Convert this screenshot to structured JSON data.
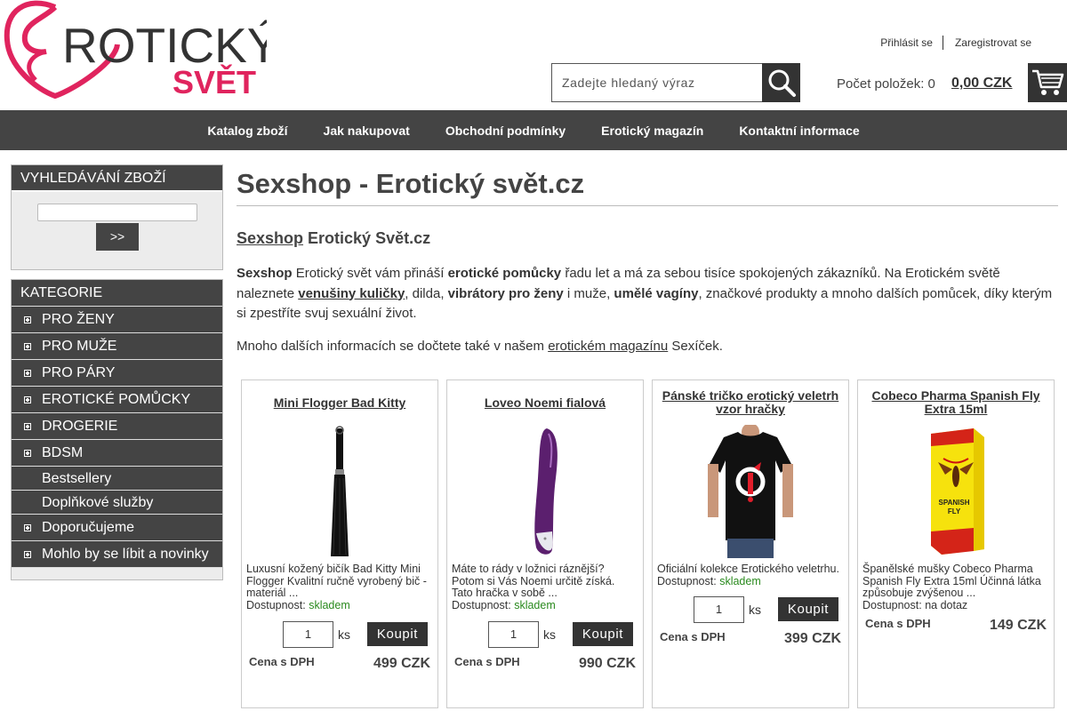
{
  "logo": {
    "word1": "ROTICKÝ",
    "word2": "SVĚT",
    "brand_color": "#e0245e"
  },
  "header": {
    "login": "Přihlásit se",
    "register": "Zaregistrovat se",
    "search_placeholder": "Zadejte hledaný výraz",
    "search_icon": "magnifier-icon",
    "cart_count_label": "Počet položek: 0",
    "cart_total": "0,00 CZK",
    "cart_icon": "cart-icon"
  },
  "nav": [
    "Katalog zboží",
    "Jak nakupovat",
    "Obchodní podmínky",
    "Erotický magazín",
    "Kontaktní informace"
  ],
  "sidebar": {
    "search_title": "VYHLEDÁVÁNÍ ZBOŽÍ",
    "search_button": ">>",
    "categories_title": "KATEGORIE",
    "categories": [
      {
        "label": "PRO ŽENY",
        "expandable": true
      },
      {
        "label": "PRO MUŽE",
        "expandable": true
      },
      {
        "label": "PRO PÁRY",
        "expandable": true
      },
      {
        "label": "EROTICKÉ POMŮCKY",
        "expandable": true
      },
      {
        "label": "DROGERIE",
        "expandable": true
      },
      {
        "label": "BDSM",
        "expandable": true
      },
      {
        "label": "Bestsellery",
        "expandable": false
      },
      {
        "label": "Doplňkové služby",
        "expandable": false
      },
      {
        "label": "Doporučujeme",
        "expandable": true
      },
      {
        "label": "Mohlo by se líbit a novinky",
        "expandable": true
      }
    ]
  },
  "main": {
    "title": "Sexshop - Erotický svět.cz",
    "subtitle_link": "Sexshop",
    "subtitle_rest": " Erotický Svět.cz",
    "p1": {
      "s1": "Sexshop",
      "t1": " Erotický svět vám přináší ",
      "s2": "erotické pomůcky",
      "t2": " řadu let a má za sebou tisíce spokojených zákazníků. Na Erotickém světě naleznete ",
      "l1": "venušiny kuličky",
      "t3": ", dilda, ",
      "s3": "vibrátory pro ženy",
      "t4": " i muže, ",
      "s4": "umělé vagíny",
      "t5": ", značkové produkty a mnoho dalších pomůcek, díky kterým si zpestříte svuj sexuální život."
    },
    "p2": {
      "t1": "Mnoho dalších informacích se dočtete také v našem ",
      "l1": "erotickém magazínu",
      "t2": " Sexíček."
    }
  },
  "products": [
    {
      "name": "Mini Flogger Bad Kitty",
      "description": "Luxusní kožený bičík Bad Kitty Mini Flogger Kvalitní ručně vyrobený bič - materiál ...",
      "availability_label": "Dostupnost:",
      "availability": "skladem",
      "qty": "1",
      "unit": "ks",
      "buy": "Koupit",
      "vat_label": "Cena s DPH",
      "price": "499 CZK",
      "image": "flogger-image"
    },
    {
      "name": "Loveo Noemi fialová",
      "description": "Máte to rády v ložnici ráznější? Potom si Vás Noemi určitě získá. Tato hračka v sobě ...",
      "availability_label": "Dostupnost:",
      "availability": "skladem",
      "qty": "1",
      "unit": "ks",
      "buy": "Koupit",
      "vat_label": "Cena s DPH",
      "price": "990 CZK",
      "image": "vibrator-image"
    },
    {
      "name": "Pánské tričko erotický veletrh vzor hračky",
      "description": "Oficiální kolekce Erotického veletrhu.",
      "availability_label": "Dostupnost:",
      "availability": "skladem",
      "qty": "1",
      "unit": "ks",
      "buy": "Koupit",
      "vat_label": "Cena s DPH",
      "price": "399 CZK",
      "image": "tshirt-image"
    },
    {
      "name": "Cobeco Pharma Spanish Fly Extra 15ml",
      "description": "Španělské mušky Cobeco Pharma Spanish Fly Extra 15ml Účinná látka způsobuje zvýšenou ...",
      "availability_label": "Dostupnost:",
      "availability": "na dotaz",
      "vat_label": "Cena s DPH",
      "price": "149 CZK",
      "image": "spanish-fly-image",
      "box_text": "SPANISH FLY"
    }
  ]
}
